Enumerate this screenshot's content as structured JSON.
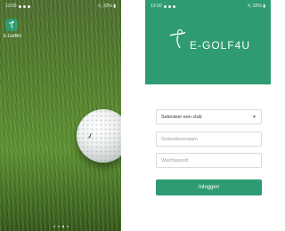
{
  "left_screen": {
    "status": {
      "time": "13:00",
      "right": "¹⁄₂ 32% ▮"
    },
    "app_icon": {
      "label": "E-Golf4U",
      "icon": "golfer-icon"
    }
  },
  "right_screen": {
    "status": {
      "time": "13:00",
      "right": "²⁄₂ 32% ▮"
    },
    "brand": {
      "logo_text": "E-GOLF4U",
      "color": "#2f9b72"
    },
    "form": {
      "club_select": "Selecteer een club",
      "username_placeholder": "Gebruikersnaam",
      "password_placeholder": "Wachtwoord",
      "login_label": "Inloggen"
    }
  }
}
